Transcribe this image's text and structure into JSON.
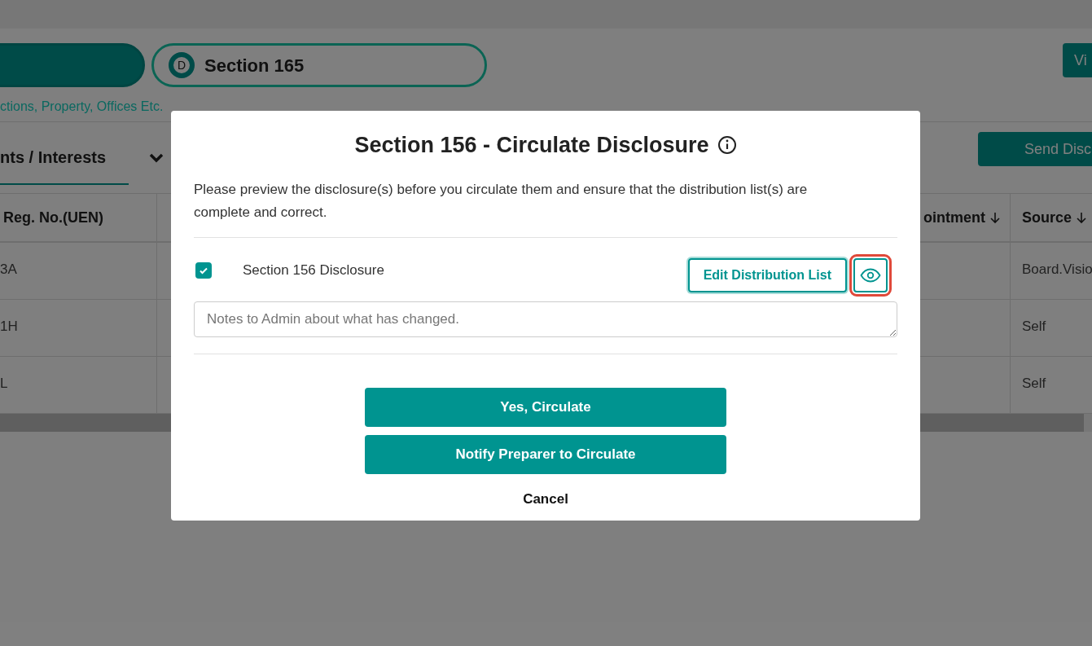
{
  "section_tabs": [
    {
      "selected": true
    },
    {
      "badge": "D",
      "label": "Section 165",
      "selected": false
    }
  ],
  "subtitle": "ctions, Property, Offices Etc.",
  "view_button": "Vi",
  "tab": {
    "label": "nts / Interests",
    "selected": true
  },
  "send_button": "Send Disc",
  "table": {
    "columns": [
      "Reg. No.(UEN)",
      "ointment",
      "Source"
    ],
    "rows": [
      [
        "3A",
        "",
        "Board.Visio"
      ],
      [
        "1H",
        "",
        "Self"
      ],
      [
        "L",
        "",
        "Self"
      ]
    ]
  },
  "dialog": {
    "title": "Section 156 - Circulate Disclosure",
    "description": "Please preview the disclosure(s) before you circulate them and ensure that the distribution list(s) are complete and correct.",
    "items": [
      {
        "label": "Section 156 Disclosure",
        "checked": true,
        "edit_button": "Edit Distribution List",
        "preview_highlighted": true
      }
    ],
    "notes": {
      "placeholder": "Notes to Admin about what has changed."
    },
    "buttons": [
      "Yes, Circulate",
      "Notify Preparer to Circulate"
    ],
    "cancel": "Cancel"
  }
}
